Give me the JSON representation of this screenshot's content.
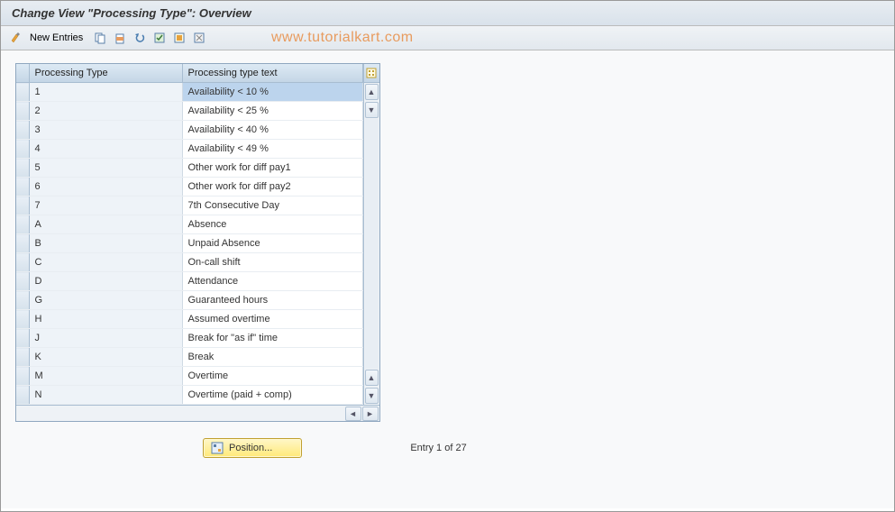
{
  "title": "Change View \"Processing Type\": Overview",
  "toolbar": {
    "new_entries_label": "New Entries"
  },
  "watermark": "www.tutorialkart.com",
  "table": {
    "columns": {
      "processing_type": "Processing Type",
      "processing_type_text": "Processing type text"
    },
    "rows": [
      {
        "type": "1",
        "text": "Availability < 10 %",
        "selected": true
      },
      {
        "type": "2",
        "text": "Availability < 25 %"
      },
      {
        "type": "3",
        "text": "Availability < 40 %"
      },
      {
        "type": "4",
        "text": "Availability < 49 %"
      },
      {
        "type": "5",
        "text": "Other work for diff pay1"
      },
      {
        "type": "6",
        "text": "Other work for diff pay2"
      },
      {
        "type": "7",
        "text": "7th Consecutive Day"
      },
      {
        "type": "A",
        "text": "Absence"
      },
      {
        "type": "B",
        "text": "Unpaid Absence"
      },
      {
        "type": "C",
        "text": "On-call shift"
      },
      {
        "type": "D",
        "text": "Attendance"
      },
      {
        "type": "G",
        "text": "Guaranteed hours"
      },
      {
        "type": "H",
        "text": "Assumed overtime"
      },
      {
        "type": "J",
        "text": "Break for \"as if\" time"
      },
      {
        "type": "K",
        "text": "Break"
      },
      {
        "type": "M",
        "text": "Overtime"
      },
      {
        "type": "N",
        "text": "Overtime (paid + comp)"
      }
    ]
  },
  "footer": {
    "position_label": "Position...",
    "entry_text": "Entry 1 of 27"
  }
}
